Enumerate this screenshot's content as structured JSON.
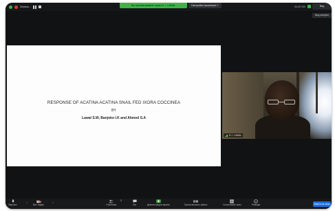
{
  "topbar": {
    "recording_label": "Запись...",
    "share_banner": "Вы просматриваете экран Н. I. LAWAL",
    "view_options": "Настройки просмотра ˅",
    "time": "21:07:33",
    "view_button": "Вид",
    "gallery_label": "Вид галереи"
  },
  "slide": {
    "title": "RESPONSE OF ACATINA ACATINA SNAIL FED IXORA COCCINEA",
    "by": "BY",
    "authors": "Lawal S.W, Banjoko I.K and Ahmed S.A"
  },
  "video": {
    "participant_name": "Н. I. LAWAL"
  },
  "toolbar": {
    "mute_label": "Звук вкл.",
    "video_label": "Вкл. видео",
    "participants_label": "Участники",
    "participants_count": "3",
    "chat_label": "Чат",
    "share_label": "Демонстрация экрана",
    "record_label": "Приостановить запись",
    "breakout_label": "Сессионные залы",
    "reactions_label": "Реакции",
    "end_label": "Выйти из зала"
  },
  "colors": {
    "share_green": "#3cb449",
    "end_blue": "#1a6fe0",
    "record_red": "#e8362b"
  }
}
